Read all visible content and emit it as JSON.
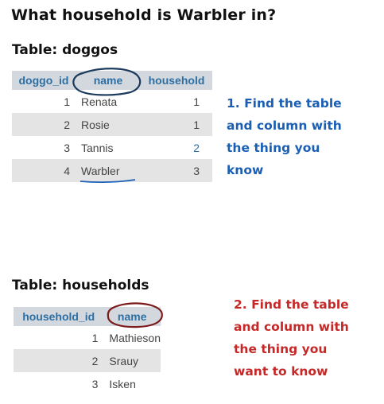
{
  "question": "What household is Warbler in?",
  "doggos": {
    "label": "Table: doggos",
    "columns": [
      "doggo_id",
      "name",
      "household"
    ],
    "rows": [
      {
        "id": "1",
        "name": "Renata",
        "household": "1"
      },
      {
        "id": "2",
        "name": "Rosie",
        "household": "1"
      },
      {
        "id": "3",
        "name": "Tannis",
        "household": "2"
      },
      {
        "id": "4",
        "name": "Warbler",
        "household": "3"
      }
    ]
  },
  "households": {
    "label": "Table: households",
    "columns": [
      "household_id",
      "name"
    ],
    "rows": [
      {
        "id": "1",
        "name": "Mathieson"
      },
      {
        "id": "2",
        "name": "Srauy"
      },
      {
        "id": "3",
        "name": "Isken"
      }
    ]
  },
  "annotations": {
    "note1": "1. Find the table\nand column with\nthe thing you\nknow",
    "note2": "2. Find the table\nand column with\nthe thing you\nwant to know",
    "note1_color": "#1a5fb4",
    "note2_color": "#c62828"
  }
}
